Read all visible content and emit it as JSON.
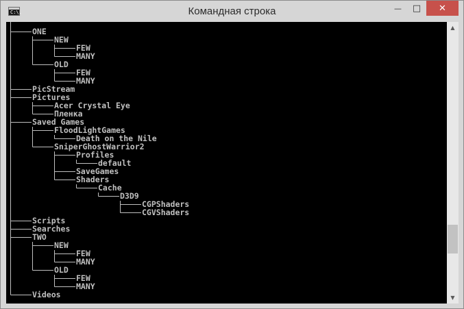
{
  "window": {
    "title": "Командная строка",
    "icon_text": "C:\\."
  },
  "controls": {
    "minimize": "—",
    "maximize": "□",
    "close": "✕"
  },
  "tree": [
    {
      "label": "ONE",
      "depth": 0
    },
    {
      "label": "NEW",
      "depth": 1
    },
    {
      "label": "FEW",
      "depth": 2
    },
    {
      "label": "MANY",
      "depth": 2
    },
    {
      "label": "OLD",
      "depth": 1
    },
    {
      "label": "FEW",
      "depth": 2
    },
    {
      "label": "MANY",
      "depth": 2
    },
    {
      "label": "PicStream",
      "depth": 0
    },
    {
      "label": "Pictures",
      "depth": 0
    },
    {
      "label": "Acer Crystal Eye",
      "depth": 1
    },
    {
      "label": "Пленка",
      "depth": 1
    },
    {
      "label": "Saved Games",
      "depth": 0
    },
    {
      "label": "FloodLightGames",
      "depth": 1
    },
    {
      "label": "Death on the Nile",
      "depth": 2
    },
    {
      "label": "SniperGhostWarrior2",
      "depth": 1
    },
    {
      "label": "Profiles",
      "depth": 2
    },
    {
      "label": "default",
      "depth": 3
    },
    {
      "label": "SaveGames",
      "depth": 2
    },
    {
      "label": "Shaders",
      "depth": 2
    },
    {
      "label": "Cache",
      "depth": 3
    },
    {
      "label": "D3D9",
      "depth": 4
    },
    {
      "label": "CGPShaders",
      "depth": 5
    },
    {
      "label": "CGVShaders",
      "depth": 5
    },
    {
      "label": "Scripts",
      "depth": 0
    },
    {
      "label": "Searches",
      "depth": 0
    },
    {
      "label": "TWO",
      "depth": 0
    },
    {
      "label": "NEW",
      "depth": 1
    },
    {
      "label": "FEW",
      "depth": 2
    },
    {
      "label": "MANY",
      "depth": 2
    },
    {
      "label": "OLD",
      "depth": 1
    },
    {
      "label": "FEW",
      "depth": 2
    },
    {
      "label": "MANY",
      "depth": 2
    },
    {
      "label": "Videos",
      "depth": 0
    }
  ],
  "scrollbar": {
    "up": "▲",
    "down": "▼",
    "position": 0.78
  },
  "colors": {
    "console_bg": "#000000",
    "console_text": "#c0c0c0",
    "close_button": "#c7514b"
  }
}
